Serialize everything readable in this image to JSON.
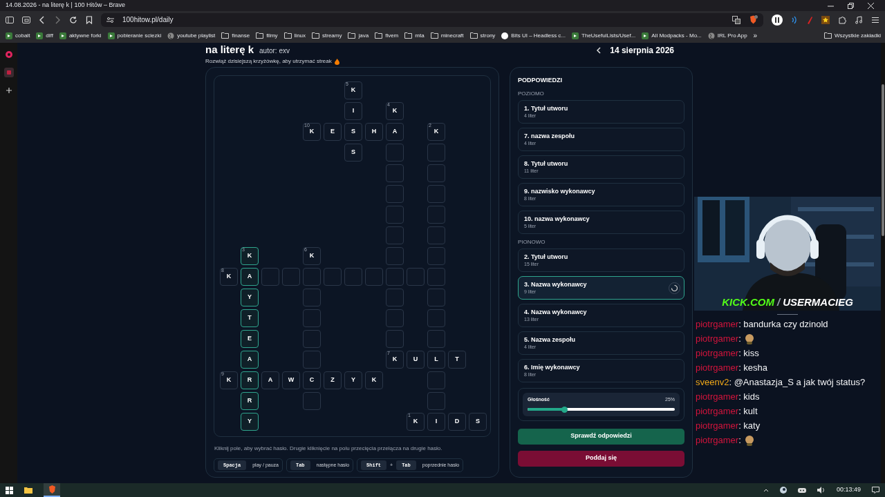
{
  "window": {
    "title": "14.08.2026 - na literę k | 100 Hitów – Brave"
  },
  "address_bar": {
    "url": "100hitow.pl/daily"
  },
  "bookmarks": [
    {
      "label": "cobalt",
      "kind": "site"
    },
    {
      "label": "diff",
      "kind": "site"
    },
    {
      "label": "aktywne forki",
      "kind": "site"
    },
    {
      "label": "pobieranie sciezki",
      "kind": "site"
    },
    {
      "label": "youtube playlist",
      "kind": "globe"
    },
    {
      "label": "finanse",
      "kind": "folder"
    },
    {
      "label": "filmy",
      "kind": "folder"
    },
    {
      "label": "linux",
      "kind": "folder"
    },
    {
      "label": "streamy",
      "kind": "folder"
    },
    {
      "label": "java",
      "kind": "folder"
    },
    {
      "label": "fivem",
      "kind": "folder"
    },
    {
      "label": "mta",
      "kind": "folder"
    },
    {
      "label": "minecraft",
      "kind": "folder"
    },
    {
      "label": "strony",
      "kind": "folder"
    },
    {
      "label": "Bits UI – Headless c...",
      "kind": "circle"
    },
    {
      "label": "TheUsefulLists/Usef...",
      "kind": "site"
    },
    {
      "label": "All Modpacks - Mo...",
      "kind": "site"
    },
    {
      "label": "IRL Pro App",
      "kind": "globe"
    }
  ],
  "bookmarks_more": "»",
  "all_bookmarks": "Wszystkie zakładki",
  "page": {
    "title": "na literę k",
    "author": "autor: exv",
    "subtitle": "Rozwiąż dzisiejszą krzyżówkę, aby utrzymać streak",
    "date": "14 sierpnia 2026"
  },
  "crossword": {
    "rows": [
      [
        {
          "kind": "void"
        },
        {
          "kind": "void"
        },
        {
          "kind": "void"
        },
        {
          "kind": "void"
        },
        {
          "kind": "void"
        },
        {
          "kind": "void"
        },
        {
          "kind": "cell",
          "letter": "K",
          "number": "5",
          "highlighted": false
        }
      ],
      [
        {
          "kind": "void"
        },
        {
          "kind": "void"
        },
        {
          "kind": "void"
        },
        {
          "kind": "void"
        },
        {
          "kind": "void"
        },
        {
          "kind": "void"
        },
        {
          "kind": "cell",
          "letter": "I",
          "highlighted": false
        },
        {
          "kind": "void"
        },
        {
          "kind": "cell",
          "letter": "K",
          "number": "4",
          "highlighted": false
        }
      ],
      [
        {
          "kind": "void"
        },
        {
          "kind": "void"
        },
        {
          "kind": "void"
        },
        {
          "kind": "void"
        },
        {
          "kind": "cell",
          "letter": "K",
          "number": "10",
          "highlighted": false
        },
        {
          "kind": "cell",
          "letter": "E",
          "highlighted": false
        },
        {
          "kind": "cell",
          "letter": "S",
          "highlighted": false
        },
        {
          "kind": "cell",
          "letter": "H",
          "highlighted": false
        },
        {
          "kind": "cell",
          "letter": "A",
          "highlighted": false
        },
        {
          "kind": "void"
        },
        {
          "kind": "cell",
          "letter": "K",
          "number": "2",
          "highlighted": false
        }
      ],
      [
        {
          "kind": "void"
        },
        {
          "kind": "void"
        },
        {
          "kind": "void"
        },
        {
          "kind": "void"
        },
        {
          "kind": "void"
        },
        {
          "kind": "void"
        },
        {
          "kind": "cell",
          "letter": "S",
          "highlighted": false
        },
        {
          "kind": "void"
        },
        {
          "kind": "cell",
          "highlighted": false
        },
        {
          "kind": "void"
        },
        {
          "kind": "cell",
          "highlighted": false
        }
      ],
      [
        {
          "kind": "void"
        },
        {
          "kind": "void"
        },
        {
          "kind": "void"
        },
        {
          "kind": "void"
        },
        {
          "kind": "void"
        },
        {
          "kind": "void"
        },
        {
          "kind": "void"
        },
        {
          "kind": "void"
        },
        {
          "kind": "cell",
          "highlighted": false
        },
        {
          "kind": "void"
        },
        {
          "kind": "cell",
          "highlighted": false
        }
      ],
      [
        {
          "kind": "void"
        },
        {
          "kind": "void"
        },
        {
          "kind": "void"
        },
        {
          "kind": "void"
        },
        {
          "kind": "void"
        },
        {
          "kind": "void"
        },
        {
          "kind": "void"
        },
        {
          "kind": "void"
        },
        {
          "kind": "cell",
          "highlighted": false
        },
        {
          "kind": "void"
        },
        {
          "kind": "cell",
          "highlighted": false
        }
      ],
      [
        {
          "kind": "void"
        },
        {
          "kind": "void"
        },
        {
          "kind": "void"
        },
        {
          "kind": "void"
        },
        {
          "kind": "void"
        },
        {
          "kind": "void"
        },
        {
          "kind": "void"
        },
        {
          "kind": "void"
        },
        {
          "kind": "cell",
          "highlighted": false
        },
        {
          "kind": "void"
        },
        {
          "kind": "cell",
          "highlighted": false
        }
      ],
      [
        {
          "kind": "void"
        },
        {
          "kind": "void"
        },
        {
          "kind": "void"
        },
        {
          "kind": "void"
        },
        {
          "kind": "void"
        },
        {
          "kind": "void"
        },
        {
          "kind": "void"
        },
        {
          "kind": "void"
        },
        {
          "kind": "cell",
          "highlighted": false
        },
        {
          "kind": "void"
        },
        {
          "kind": "cell",
          "highlighted": false
        }
      ],
      [
        {
          "kind": "void"
        },
        {
          "kind": "cell",
          "letter": "K",
          "number": "3",
          "highlighted": true
        },
        {
          "kind": "void"
        },
        {
          "kind": "void"
        },
        {
          "kind": "cell",
          "letter": "K",
          "number": "6",
          "highlighted": false
        },
        {
          "kind": "void"
        },
        {
          "kind": "void"
        },
        {
          "kind": "void"
        },
        {
          "kind": "cell",
          "highlighted": false
        },
        {
          "kind": "void"
        },
        {
          "kind": "cell",
          "highlighted": false
        }
      ],
      [
        {
          "kind": "cell",
          "letter": "K",
          "number": "8",
          "highlighted": false
        },
        {
          "kind": "cell",
          "letter": "A",
          "highlighted": true
        },
        {
          "kind": "cell",
          "highlighted": false
        },
        {
          "kind": "cell",
          "highlighted": false
        },
        {
          "kind": "cell",
          "highlighted": false
        },
        {
          "kind": "cell",
          "highlighted": false
        },
        {
          "kind": "cell",
          "highlighted": false
        },
        {
          "kind": "cell",
          "highlighted": false
        },
        {
          "kind": "cell",
          "highlighted": false
        },
        {
          "kind": "cell",
          "highlighted": false
        },
        {
          "kind": "cell",
          "highlighted": false
        }
      ],
      [
        {
          "kind": "void"
        },
        {
          "kind": "cell",
          "letter": "Y",
          "highlighted": true
        },
        {
          "kind": "void"
        },
        {
          "kind": "void"
        },
        {
          "kind": "cell",
          "highlighted": false
        },
        {
          "kind": "void"
        },
        {
          "kind": "void"
        },
        {
          "kind": "void"
        },
        {
          "kind": "cell",
          "highlighted": false
        },
        {
          "kind": "void"
        },
        {
          "kind": "cell",
          "highlighted": false
        }
      ],
      [
        {
          "kind": "void"
        },
        {
          "kind": "cell",
          "letter": "T",
          "highlighted": true
        },
        {
          "kind": "void"
        },
        {
          "kind": "void"
        },
        {
          "kind": "cell",
          "highlighted": false
        },
        {
          "kind": "void"
        },
        {
          "kind": "void"
        },
        {
          "kind": "void"
        },
        {
          "kind": "cell",
          "highlighted": false
        },
        {
          "kind": "void"
        },
        {
          "kind": "cell",
          "highlighted": false
        }
      ],
      [
        {
          "kind": "void"
        },
        {
          "kind": "cell",
          "letter": "E",
          "highlighted": true
        },
        {
          "kind": "void"
        },
        {
          "kind": "void"
        },
        {
          "kind": "cell",
          "highlighted": false
        },
        {
          "kind": "void"
        },
        {
          "kind": "void"
        },
        {
          "kind": "void"
        },
        {
          "kind": "cell",
          "highlighted": false
        },
        {
          "kind": "void"
        },
        {
          "kind": "cell",
          "highlighted": false
        }
      ],
      [
        {
          "kind": "void"
        },
        {
          "kind": "cell",
          "letter": "A",
          "highlighted": true
        },
        {
          "kind": "void"
        },
        {
          "kind": "void"
        },
        {
          "kind": "cell",
          "highlighted": false
        },
        {
          "kind": "void"
        },
        {
          "kind": "void"
        },
        {
          "kind": "void"
        },
        {
          "kind": "cell",
          "letter": "K",
          "number": "7",
          "highlighted": false
        },
        {
          "kind": "cell",
          "letter": "U",
          "highlighted": false
        },
        {
          "kind": "cell",
          "letter": "L",
          "highlighted": false
        },
        {
          "kind": "cell",
          "letter": "T",
          "highlighted": false
        }
      ],
      [
        {
          "kind": "cell",
          "letter": "K",
          "number": "9",
          "highlighted": false
        },
        {
          "kind": "cell",
          "letter": "R",
          "highlighted": true
        },
        {
          "kind": "cell",
          "letter": "A",
          "highlighted": false
        },
        {
          "kind": "cell",
          "letter": "W",
          "highlighted": false
        },
        {
          "kind": "cell",
          "letter": "C",
          "highlighted": false
        },
        {
          "kind": "cell",
          "letter": "Z",
          "highlighted": false
        },
        {
          "kind": "cell",
          "letter": "Y",
          "highlighted": false
        },
        {
          "kind": "cell",
          "letter": "K",
          "highlighted": false
        },
        {
          "kind": "void"
        },
        {
          "kind": "void"
        },
        {
          "kind": "cell",
          "highlighted": false
        }
      ],
      [
        {
          "kind": "void"
        },
        {
          "kind": "cell",
          "letter": "R",
          "highlighted": true
        },
        {
          "kind": "void"
        },
        {
          "kind": "void"
        },
        {
          "kind": "cell",
          "highlighted": false
        },
        {
          "kind": "void"
        },
        {
          "kind": "void"
        },
        {
          "kind": "void"
        },
        {
          "kind": "void"
        },
        {
          "kind": "void"
        },
        {
          "kind": "cell",
          "highlighted": false
        }
      ],
      [
        {
          "kind": "void"
        },
        {
          "kind": "cell",
          "letter": "Y",
          "highlighted": true
        },
        {
          "kind": "void"
        },
        {
          "kind": "void"
        },
        {
          "kind": "void"
        },
        {
          "kind": "void"
        },
        {
          "kind": "void"
        },
        {
          "kind": "void"
        },
        {
          "kind": "void"
        },
        {
          "kind": "cell",
          "letter": "K",
          "number": "1",
          "highlighted": false
        },
        {
          "kind": "cell",
          "letter": "I",
          "highlighted": false
        },
        {
          "kind": "cell",
          "letter": "D",
          "highlighted": false
        },
        {
          "kind": "cell",
          "letter": "S",
          "highlighted": false
        }
      ]
    ],
    "help": "Kliknij pole, aby wybrać hasło. Drugie kliknięcie na polu przecięcia przełącza na drugie hasło.",
    "shortcuts": [
      {
        "keys": [
          "Spacja"
        ],
        "action": "play / pauza"
      },
      {
        "keys": [
          "Tab"
        ],
        "action": "następne hasło"
      },
      {
        "keys": [
          "Shift",
          "Tab"
        ],
        "separator": "+",
        "action": "poprzednie hasło"
      }
    ]
  },
  "clues": {
    "title": "PODPOWIEDZI",
    "groups": [
      {
        "heading": "POZIOMO",
        "items": [
          {
            "label": "1. Tytuł utworu",
            "length": "4 liter",
            "selected": false
          },
          {
            "label": "7. nazwa zespołu",
            "length": "4 liter",
            "selected": false
          },
          {
            "label": "8. Tytuł utworu",
            "length": "11 liter",
            "selected": false
          },
          {
            "label": "9. nazwisko wykonawcy",
            "length": "8 liter",
            "selected": false
          },
          {
            "label": "10. nazwa wykonawcy",
            "length": "5 liter",
            "selected": false
          }
        ]
      },
      {
        "heading": "PIONOWO",
        "items": [
          {
            "label": "2. Tytuł utworu",
            "length": "15 liter",
            "selected": false
          },
          {
            "label": "3. Nazwa wykonawcy",
            "length": "9 liter",
            "selected": true
          },
          {
            "label": "4. Nazwa wykonawcy",
            "length": "13 liter",
            "selected": false
          },
          {
            "label": "5. Nazwa zespołu",
            "length": "4 liter",
            "selected": false
          },
          {
            "label": "6. Imię wykonawcy",
            "length": "8 liter",
            "selected": false
          }
        ]
      }
    ]
  },
  "volume": {
    "label": "Głośność",
    "reading": "25%",
    "level": 0.25
  },
  "buttons": [
    {
      "label": "Sprawdź odpowiedzi",
      "kind": "primary"
    },
    {
      "label": "Poddaj się",
      "kind": "danger"
    }
  ],
  "stream": {
    "site": "KICK.COM",
    "separator": "/",
    "channel": "USERMACIEG"
  },
  "chat": [
    {
      "user": "piotrgamer",
      "color": "#d4143c",
      "kind": "text",
      "text": ": bandurka czy dzinold"
    },
    {
      "user": "piotrgamer",
      "color": "#d4143c",
      "kind": "emote",
      "text": ":"
    },
    {
      "user": "piotrgamer",
      "color": "#d4143c",
      "kind": "text",
      "text": ": kiss"
    },
    {
      "user": "piotrgamer",
      "color": "#d4143c",
      "kind": "text",
      "text": ": kesha"
    },
    {
      "user": "sveenv2",
      "color": "#f0a818",
      "kind": "text",
      "text": ": @Anastazja_S a jak twój status?"
    },
    {
      "user": "piotrgamer",
      "color": "#d4143c",
      "kind": "text",
      "text": ": kids"
    },
    {
      "user": "piotrgamer",
      "color": "#d4143c",
      "kind": "text",
      "text": ": kult"
    },
    {
      "user": "piotrgamer",
      "color": "#d4143c",
      "kind": "text",
      "text": ": katy"
    },
    {
      "user": "piotrgamer",
      "color": "#d4143c",
      "kind": "emote",
      "text": ":"
    }
  ],
  "taskbar": {
    "time": "00:13:49"
  }
}
